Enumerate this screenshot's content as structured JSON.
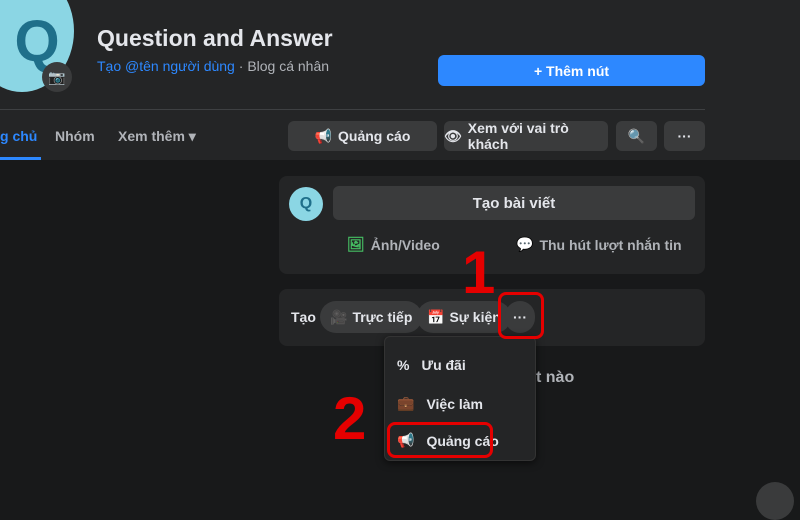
{
  "header": {
    "avatar_letter": "Q",
    "title": "Question and Answer",
    "username_link": "Tạo @tên người dùng",
    "separator": " · ",
    "category": "Blog cá nhân",
    "add_button": "+ Thêm nút"
  },
  "tabs": [
    {
      "label": "g chủ",
      "active": true
    },
    {
      "label": "Nhóm"
    },
    {
      "label": "Xem thêm ▾"
    }
  ],
  "actions": {
    "ads": "Quảng cáo",
    "view_as": "Xem với vai trò khách",
    "search_icon": "🔍",
    "more": "···"
  },
  "composer": {
    "avatar_letter": "Q",
    "placeholder": "Tạo bài viết",
    "photo": "Ảnh/Video",
    "messages": "Thu hút lượt nhắn tin"
  },
  "create": {
    "label": "Tạo",
    "live": "Trực tiếp",
    "event": "Sự kiện",
    "more": "···"
  },
  "menu": [
    {
      "label": "Ưu đãi",
      "icon": "%"
    },
    {
      "label": "Việc làm",
      "icon": "💼"
    },
    {
      "label": "Quảng cáo",
      "icon": "📢"
    }
  ],
  "background_text": "t nào",
  "annotations": {
    "step1": "1",
    "step2": "2",
    "color": "#e50000"
  }
}
